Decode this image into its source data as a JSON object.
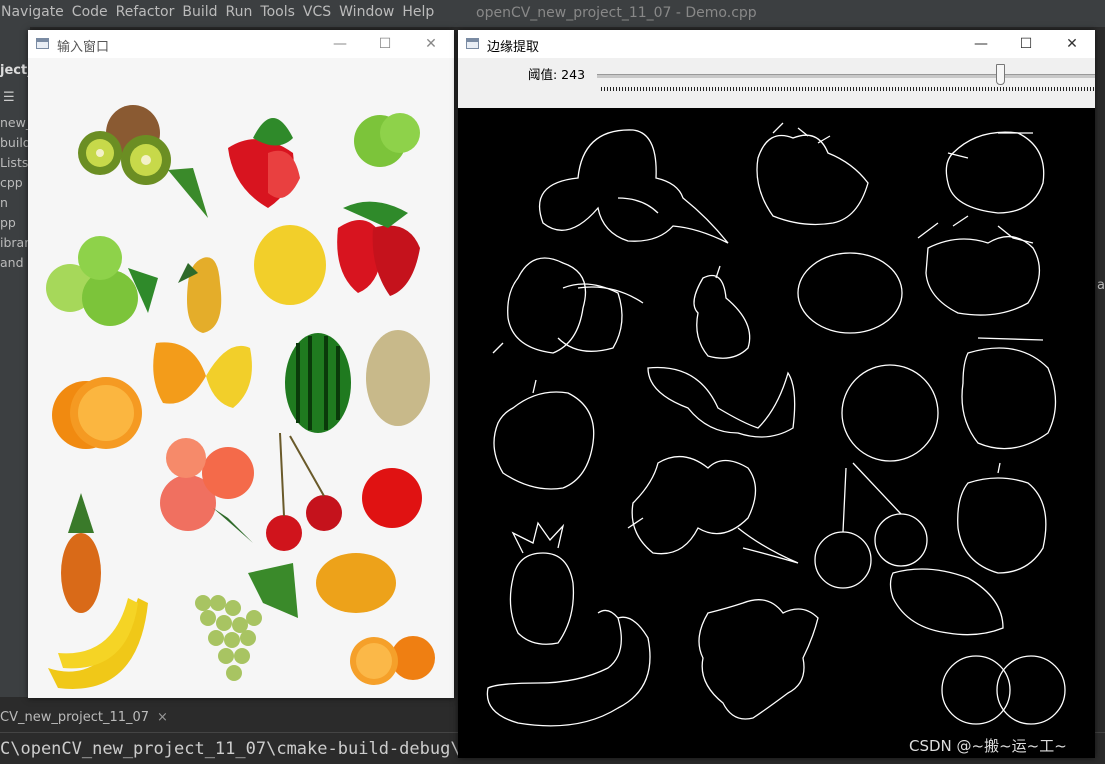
{
  "ide": {
    "menu": [
      "Navigate",
      "Code",
      "Refactor",
      "Build",
      "Run",
      "Tools",
      "VCS",
      "Window",
      "Help"
    ],
    "title": "openCV_new_project_11_07 - Demo.cpp",
    "project_label": "ject_",
    "tree": [
      "new_p",
      "build",
      "Lists.",
      "cpp",
      "n",
      "pp",
      "ibrari",
      "and"
    ],
    "right_char": "a",
    "run_tab": "CV_new_project_11_07",
    "run_tab_close": "×",
    "run_path": "C\\openCV_new_project_11_07\\cmake-build-debug\\o"
  },
  "input_window": {
    "title": "输入窗口",
    "minimize": "—",
    "maximize": "☐",
    "close": "✕"
  },
  "edge_window": {
    "title": "边缘提取",
    "minimize": "—",
    "maximize": "☐",
    "close": "✕",
    "trackbar": {
      "label": "阈值: 243",
      "value": 243,
      "fraction": 0.81
    }
  },
  "watermark": "CSDN @~搬~运~工~",
  "fruits": [
    "kiwi",
    "strawberry",
    "green-apple",
    "green-apples",
    "pear",
    "lemon",
    "strawberries",
    "orange",
    "lemon-half",
    "watermelon",
    "melon",
    "peach",
    "cherry",
    "red-apple",
    "pineapple",
    "grapes",
    "mango",
    "banana",
    "orange-halves"
  ]
}
